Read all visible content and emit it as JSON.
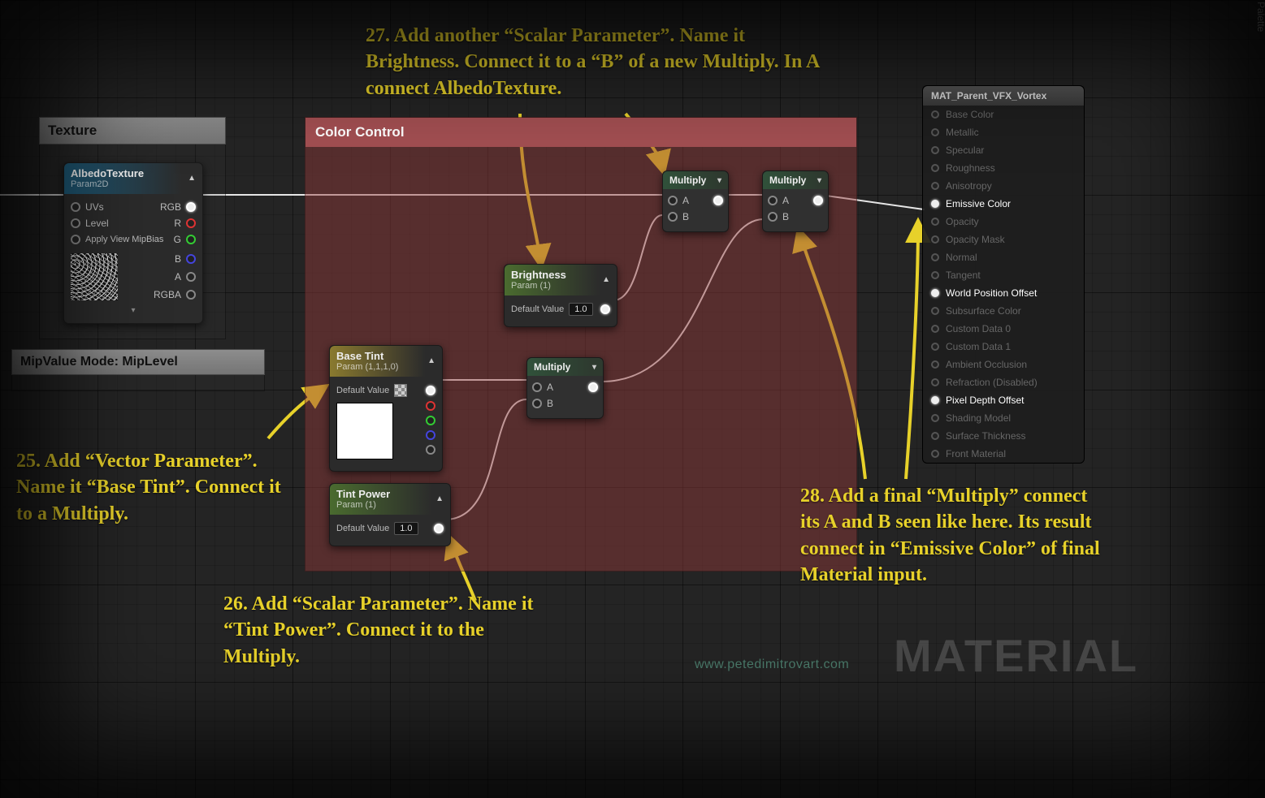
{
  "palette_label": "Palette",
  "comments": {
    "texture": "Texture",
    "mip": "MipValue Mode: MipLevel",
    "color_control": "Color Control"
  },
  "nodes": {
    "albedo": {
      "title": "AlbedoTexture",
      "subtitle": "Param2D",
      "pins_left": [
        "UVs",
        "Level",
        "Apply View MipBias"
      ],
      "pins_right": [
        "RGB",
        "R",
        "G",
        "B",
        "A",
        "RGBA"
      ]
    },
    "brightness": {
      "title": "Brightness",
      "subtitle": "Param (1)",
      "field_label": "Default Value",
      "value": "1.0"
    },
    "basetint": {
      "title": "Base Tint",
      "subtitle": "Param (1,1,1,0)",
      "field_label": "Default Value"
    },
    "tintpower": {
      "title": "Tint Power",
      "subtitle": "Param (1)",
      "field_label": "Default Value",
      "value": "1.0"
    },
    "multiply": {
      "title": "Multiply",
      "a": "A",
      "b": "B"
    }
  },
  "material_output": {
    "title": "MAT_Parent_VFX_Vortex",
    "pins": [
      {
        "label": "Base Color",
        "active": false
      },
      {
        "label": "Metallic",
        "active": false
      },
      {
        "label": "Specular",
        "active": false
      },
      {
        "label": "Roughness",
        "active": false
      },
      {
        "label": "Anisotropy",
        "active": false
      },
      {
        "label": "Emissive Color",
        "active": true
      },
      {
        "label": "Opacity",
        "active": false
      },
      {
        "label": "Opacity Mask",
        "active": false
      },
      {
        "label": "Normal",
        "active": false
      },
      {
        "label": "Tangent",
        "active": false
      },
      {
        "label": "World Position Offset",
        "active": true
      },
      {
        "label": "Subsurface Color",
        "active": false
      },
      {
        "label": "Custom Data 0",
        "active": false
      },
      {
        "label": "Custom Data 1",
        "active": false
      },
      {
        "label": "Ambient Occlusion",
        "active": false
      },
      {
        "label": "Refraction (Disabled)",
        "active": false
      },
      {
        "label": "Pixel Depth Offset",
        "active": true
      },
      {
        "label": "Shading Model",
        "active": false
      },
      {
        "label": "Surface Thickness",
        "active": false
      },
      {
        "label": "Front Material",
        "active": false
      }
    ]
  },
  "annotations": {
    "a25": "25. Add “Vector Parameter”. Name it “Base Tint”. Connect it to a Multiply.",
    "a26": "26. Add “Scalar Parameter”. Name it “Tint Power”. Connect it to the Multiply.",
    "a27": "27. Add another “Scalar Parameter”. Name it Brightness. Connect it to a “B” of a new Multiply. In A connect AlbedoTexture.",
    "a28": "28. Add a final “Multiply” connect its A and B seen like here. Its result connect in “Emissive Color” of final Material input."
  },
  "credits": "www.petedimitrovart.com",
  "watermark": "MATERIAL"
}
